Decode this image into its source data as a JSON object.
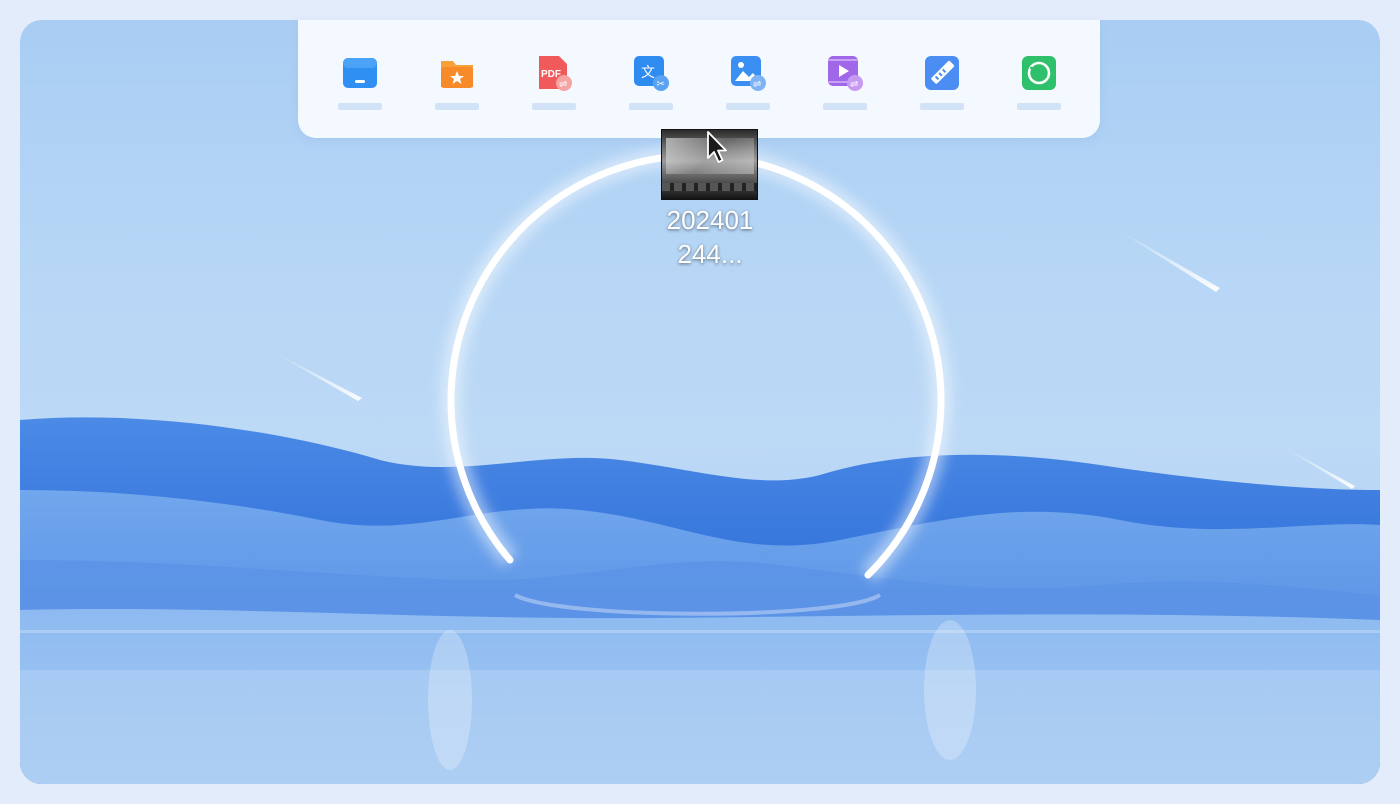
{
  "toolbar": {
    "items": [
      {
        "icon": "desktop-icon",
        "color": "#2f8ff3"
      },
      {
        "icon": "star-folder-icon",
        "color": "#f78b2a"
      },
      {
        "icon": "pdf-convert-icon",
        "color": "#f05a5a"
      },
      {
        "icon": "translate-icon",
        "color": "#2e8bf0"
      },
      {
        "icon": "image-convert-icon",
        "color": "#3b8ef2"
      },
      {
        "icon": "video-convert-icon",
        "color": "#a067e9"
      },
      {
        "icon": "edit-ruler-icon",
        "color": "#4b8df2"
      },
      {
        "icon": "record-circle-icon",
        "color": "#2fc06b"
      }
    ]
  },
  "file": {
    "name_line1": "202401",
    "name_line2": "244..."
  },
  "wallpaper": {
    "sky": "#b8d7f6",
    "dunes": "#3d7be0",
    "ring": "#ffffff"
  }
}
